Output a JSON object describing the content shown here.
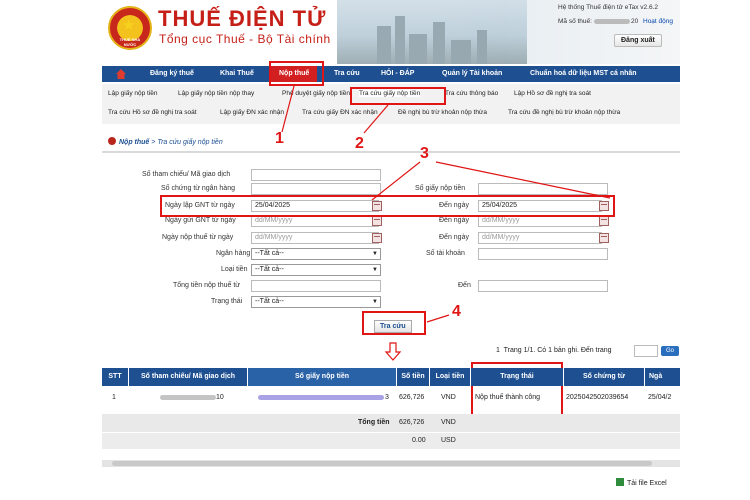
{
  "header": {
    "brand_title": "THUẾ ĐIỆN TỬ",
    "brand_subtitle": "Tổng cục Thuế - Bộ Tài chính",
    "emblem_text": "THUẾ NHÀ NƯỚC",
    "system_info": "Hệ thống Thuế điện tử eTax v2.6.2",
    "tax_id_label": "Mã số thuế:",
    "tax_id_suffix": "20",
    "activity_link": "Hoạt động",
    "logout_label": "Đăng xuất"
  },
  "nav": {
    "items": [
      "Đăng ký thuế",
      "Khai Thuế",
      "Nộp thuế",
      "Tra cứu",
      "HỎI - ĐÁP",
      "Quản lý Tài khoản",
      "Chuẩn hoá dữ liệu MST cá nhân"
    ],
    "active": "Nộp thuế"
  },
  "subnav": {
    "row1": [
      "Lập giấy nộp tiền",
      "Lập giấy nộp tiền nộp thay",
      "Phê duyệt giấy nộp tiền",
      "Tra cứu giấy nộp tiền",
      "Tra cứu thông báo",
      "Lập Hồ sơ đề nghị tra soát"
    ],
    "row2": [
      "Tra cứu Hồ sơ đề nghị tra soát",
      "Lập giấy ĐN xác nhận",
      "Tra cứu giấy ĐN xác nhận",
      "Đề nghị bù trừ khoản nộp thừa",
      "Tra cứu đề nghị bù trừ khoản nộp thừa"
    ],
    "current": "Tra cứu giấy nộp tiền"
  },
  "breadcrumb": {
    "parent": "Nộp thuế",
    "separator": " > ",
    "current": "Tra cứu giấy nộp tiền"
  },
  "form": {
    "ref_label": "Số tham chiếu/ Mã giao dịch",
    "bank_ref_label": "Số chứng từ ngân hàng",
    "doc_no_label": "Số giấy nộp tiền",
    "date_created_from_label": "Ngày lập GNT từ ngày",
    "date_created_from_value": "25/04/2025",
    "date_created_to_label": "Đến ngày",
    "date_created_to_value": "25/04/2025",
    "date_sent_from_label": "Ngày gửi GNT từ ngày",
    "date_paid_from_label": "Ngày nộp thuế từ ngày",
    "to_label": "Đến ngày",
    "date_placeholder": "dd/MM/yyyy",
    "bank_label": "Ngân hàng",
    "bank_value": "--Tất cả--",
    "account_label": "Số tài khoản",
    "currency_label": "Loại tiền",
    "currency_value": "--Tất cả--",
    "amount_from_label": "Tổng tiền nộp thuế từ",
    "amount_to_label": "Đến",
    "status_label": "Trạng thái",
    "status_value": "--Tất cả--",
    "search_button": "Tra cứu"
  },
  "annotations": [
    "1",
    "2",
    "3",
    "4"
  ],
  "pager": {
    "text": "1  Trang 1/1. Có 1 bản ghi. Đến trang",
    "go": "Go"
  },
  "table": {
    "headers": [
      "STT",
      "Số tham chiếu/ Mã giao dịch",
      "Số giấy nộp tiền",
      "Số tiền",
      "Loại tiền",
      "Trạng thái",
      "Số chứng từ",
      "Ngà"
    ],
    "row": {
      "stt": "1",
      "ref_suffix": "10",
      "doc_suffix": "3",
      "amount": "626,726",
      "currency": "VND",
      "status": "Nộp thuế thành công",
      "voucher": "20250425020396​54",
      "date": "25/04/2"
    },
    "total_label": "Tổng tiền",
    "total_vnd": "626,726",
    "total_vnd_cur": "VND",
    "total_usd": "0.00",
    "total_usd_cur": "USD"
  },
  "excel_link": "Tải file Excel"
}
